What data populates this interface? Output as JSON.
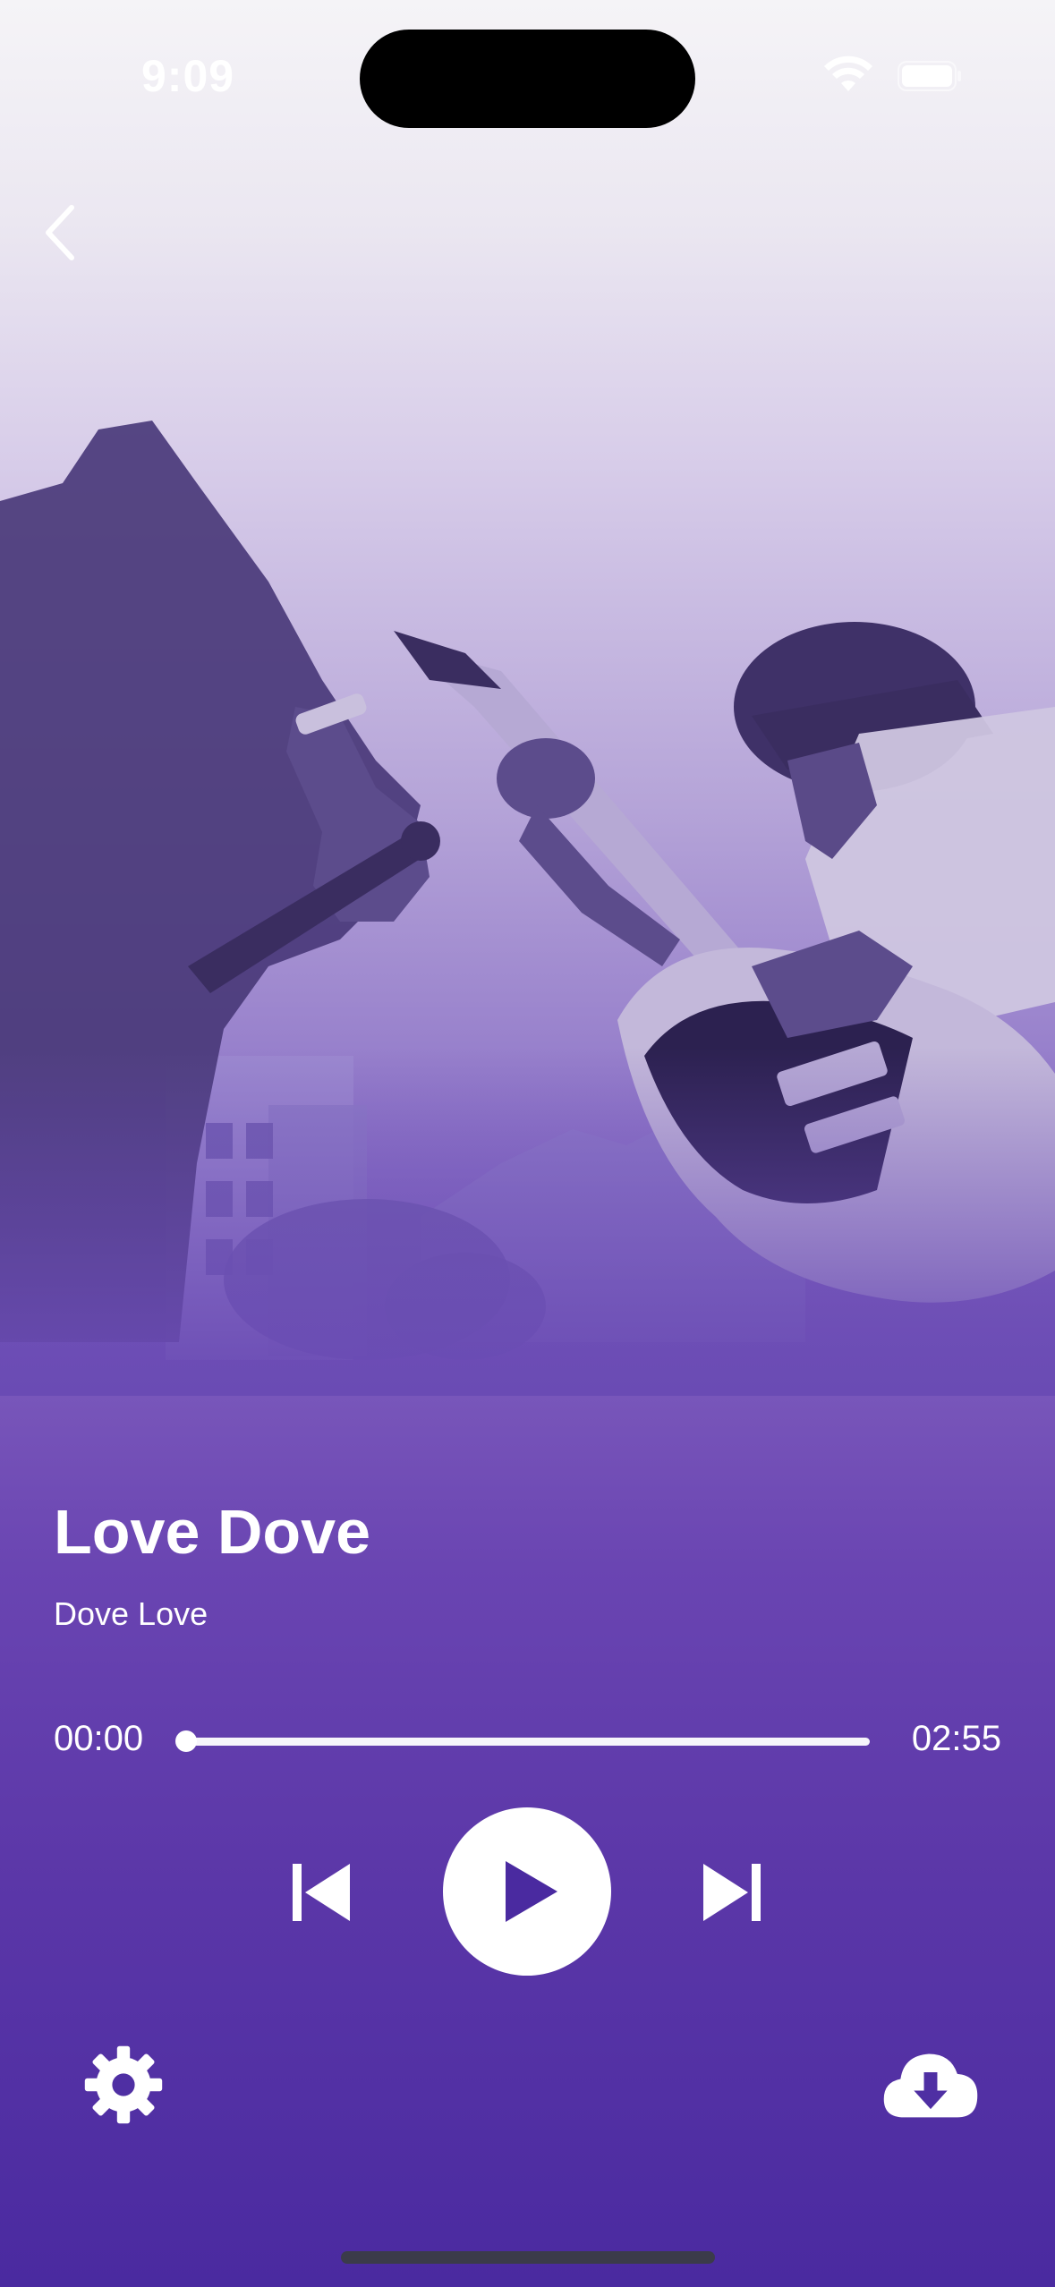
{
  "status_bar": {
    "time": "9:09",
    "icons": [
      "wifi-icon",
      "battery-icon"
    ]
  },
  "nav": {
    "back_icon": "chevron-left-icon"
  },
  "track": {
    "title": "Love Dove",
    "artist": "Dove Love"
  },
  "playback": {
    "current_time": "00:00",
    "total_time": "02:55",
    "progress": 0
  },
  "controls": {
    "previous_icon": "skip-previous-icon",
    "play_icon": "play-icon",
    "next_icon": "skip-next-icon",
    "settings_icon": "gear-icon",
    "download_icon": "cloud-download-icon"
  },
  "colors": {
    "accent": "#4a2aa0",
    "foreground": "#ffffff"
  }
}
